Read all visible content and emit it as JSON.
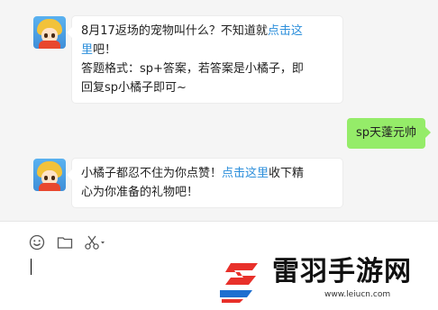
{
  "messages": [
    {
      "sender": "bot",
      "lines": [
        {
          "text": "8月17返场的宠物叫什么？不知道就",
          "link": "点击这"
        },
        {
          "link": "里",
          "text": "吧！"
        },
        {
          "text": "答题格式：sp+答案，若答案是小橘子，即"
        },
        {
          "text": "回复sp小橘子即可~"
        }
      ]
    },
    {
      "sender": "me",
      "text": "sp天蓬元帅"
    },
    {
      "sender": "bot",
      "lines": [
        {
          "text": "小橘子都忍不住为你点赞！",
          "link": "点击这里",
          "tail": "收下精"
        },
        {
          "text": "心为你准备的礼物吧！"
        }
      ]
    }
  ],
  "toolbar": {
    "icons": [
      "emoji-icon",
      "folder-icon",
      "scissors-icon"
    ]
  },
  "watermark": {
    "title": "雷羽手游网",
    "url": "www.leiucn.com",
    "color": "#e8302a"
  }
}
